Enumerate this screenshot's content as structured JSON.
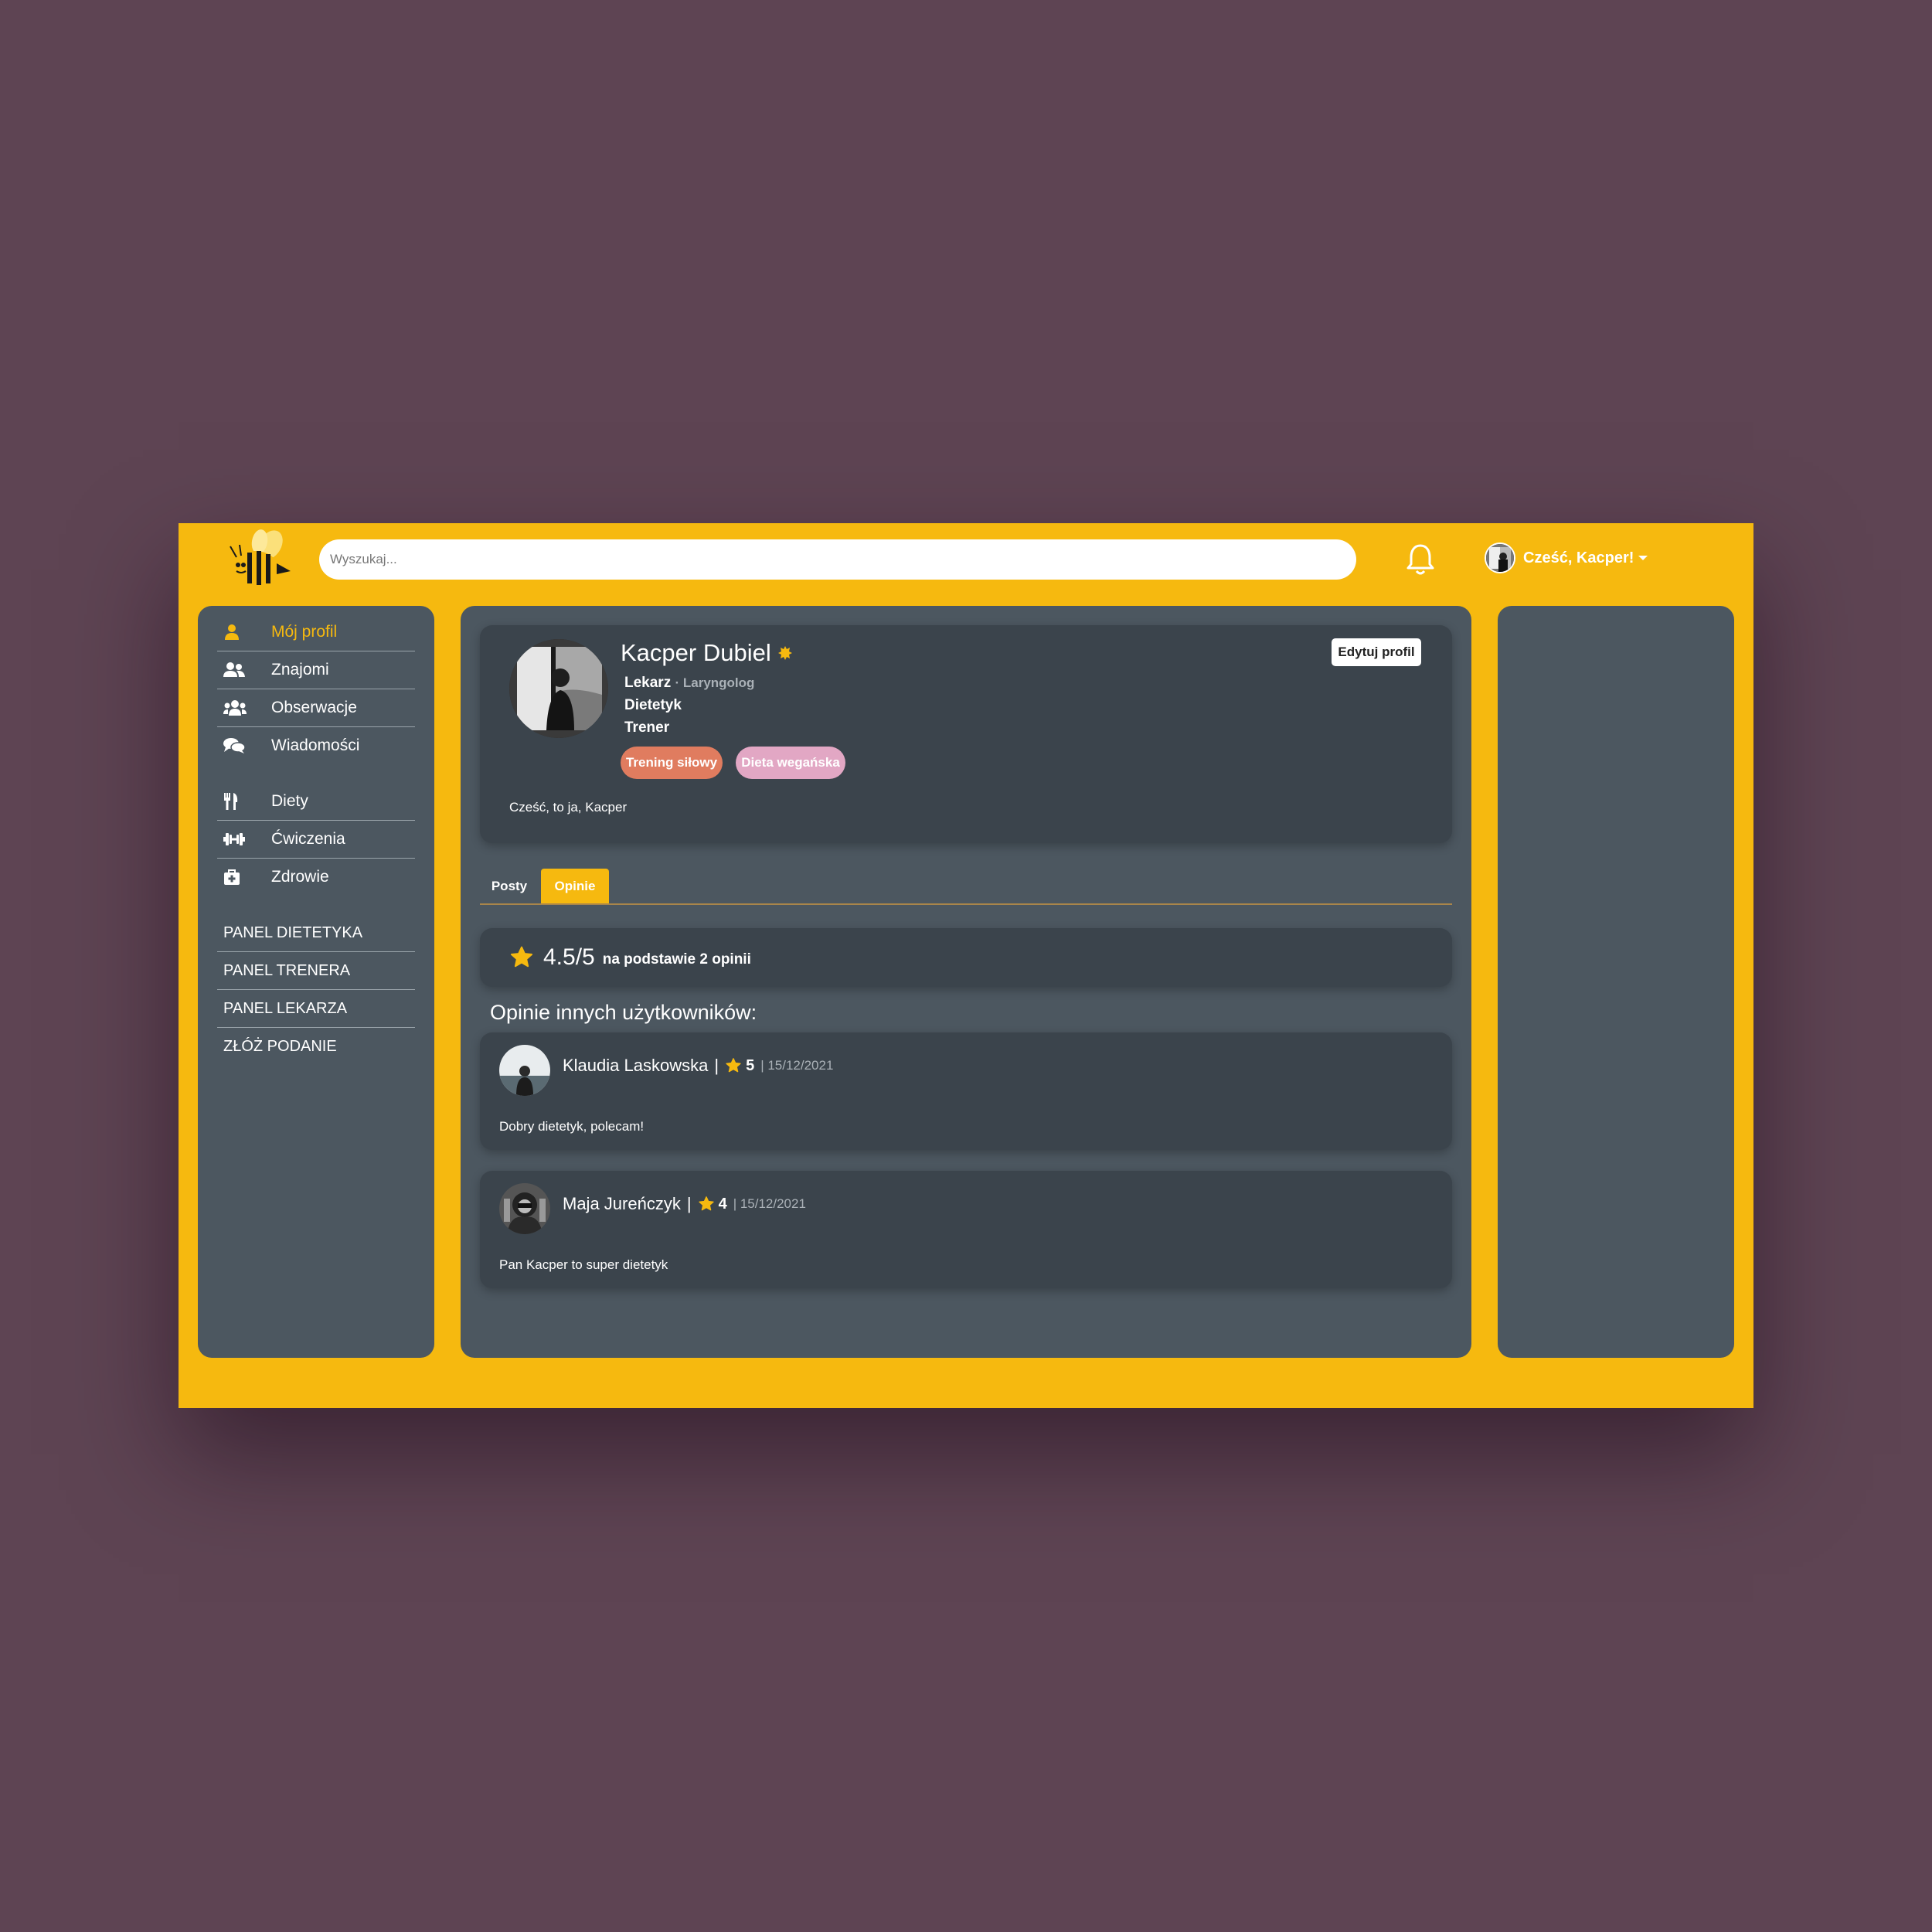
{
  "header": {
    "search_placeholder": "Wyszukaj...",
    "greeting": "Cześć, Kacper!",
    "logo_icon": "bee-logo-icon",
    "bell_icon": "bell-icon"
  },
  "sidebar": {
    "items": [
      {
        "label": "Mój profil",
        "icon": "user-icon",
        "active": true
      },
      {
        "label": "Znajomi",
        "icon": "user-friends-icon"
      },
      {
        "label": "Obserwacje",
        "icon": "users-icon"
      },
      {
        "label": "Wiadomości",
        "icon": "comments-icon"
      },
      {
        "label": "Diety",
        "icon": "utensils-icon"
      },
      {
        "label": "Ćwiczenia",
        "icon": "dumbbell-icon"
      },
      {
        "label": "Zdrowie",
        "icon": "medkit-icon"
      }
    ],
    "panels": [
      "PANEL DIETETYKA",
      "PANEL TRENERA",
      "PANEL LEKARZA",
      "ZŁÓŻ PODANIE"
    ]
  },
  "profile": {
    "name": "Kacper Dubiel",
    "roles": [
      {
        "title": "Lekarz",
        "specialty": "· Laryngolog"
      },
      {
        "title": "Dietetyk"
      },
      {
        "title": "Trener"
      }
    ],
    "tags": [
      {
        "label": "Trening siłowy",
        "color": "#e07c5f"
      },
      {
        "label": "Dieta wegańska",
        "color": "#e2a7c4"
      }
    ],
    "edit_label": "Edytuj profil",
    "bio": "Cześć, to ja, Kacper"
  },
  "tabs": [
    {
      "label": "Posty",
      "active": false
    },
    {
      "label": "Opinie",
      "active": true
    }
  ],
  "rating": {
    "value": "4.5/5",
    "basis": "na podstawie 2 opinii"
  },
  "opinions_title": "Opinie innych użytkowników:",
  "reviews": [
    {
      "name": "Klaudia Laskowska",
      "score": "5",
      "date": "| 15/12/2021",
      "text": "Dobry dietetyk, polecam!"
    },
    {
      "name": "Maja Jureńczyk",
      "score": "4",
      "date": "| 15/12/2021",
      "text": "Pan Kacper to super dietetyk"
    }
  ],
  "colors": {
    "background": "#5e4453",
    "accent": "#f6b90f",
    "panel": "#4c5760",
    "card": "#3b444c"
  }
}
